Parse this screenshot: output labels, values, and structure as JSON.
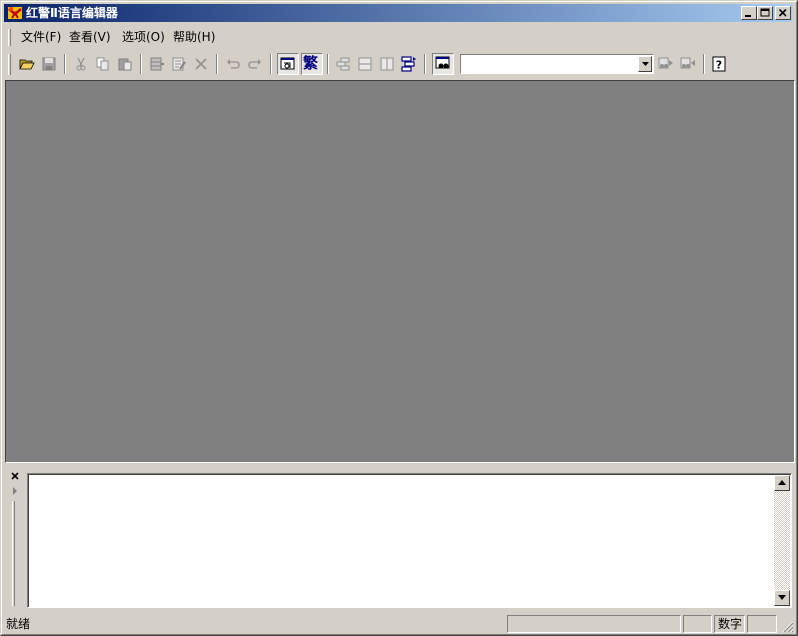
{
  "window": {
    "title": "红警Ⅱ语言编辑器",
    "controls": {
      "minimize": "minimize",
      "maximize": "maximize",
      "close": "close"
    }
  },
  "menu": {
    "items": [
      {
        "label": "文件(F)"
      },
      {
        "label": "查看(V)"
      },
      {
        "label": "选项(O)"
      },
      {
        "label": "帮助(H)"
      }
    ]
  },
  "toolbar": {
    "buttons": [
      {
        "icon": "open-folder-icon",
        "state": "enabled"
      },
      {
        "icon": "save-icon",
        "state": "disabled"
      },
      {
        "icon": "cut-icon",
        "state": "disabled"
      },
      {
        "icon": "copy-icon",
        "state": "disabled"
      },
      {
        "icon": "paste-icon",
        "state": "disabled"
      },
      {
        "icon": "insert-row-icon",
        "state": "disabled"
      },
      {
        "icon": "edit-icon",
        "state": "disabled"
      },
      {
        "icon": "delete-icon",
        "state": "disabled"
      },
      {
        "icon": "undo-icon",
        "state": "disabled"
      },
      {
        "icon": "redo-icon",
        "state": "disabled"
      },
      {
        "icon": "tool-window-icon",
        "state": "pressed"
      },
      {
        "icon": "traditional-chinese-icon",
        "label": "繁",
        "state": "pressed"
      },
      {
        "icon": "tree-view-icon",
        "state": "disabled"
      },
      {
        "icon": "horizontal-split-icon",
        "state": "disabled"
      },
      {
        "icon": "vertical-split-icon",
        "state": "disabled"
      },
      {
        "icon": "sync-tree-icon",
        "state": "enabled"
      },
      {
        "icon": "find-icon",
        "state": "pressed"
      },
      {
        "icon": "find-next-icon",
        "state": "disabled"
      },
      {
        "icon": "find-previous-icon",
        "state": "disabled"
      },
      {
        "icon": "help-icon",
        "label": "?",
        "state": "enabled"
      }
    ],
    "search_value": ""
  },
  "output_panel": {
    "close_glyph": "×",
    "content": ""
  },
  "statusbar": {
    "text": "就绪",
    "num_indicator": "数字"
  },
  "colors": {
    "title_gradient_start": "#0a246a",
    "title_gradient_end": "#a6caf0",
    "face": "#d4d0c8",
    "mdi_background": "#808080"
  }
}
